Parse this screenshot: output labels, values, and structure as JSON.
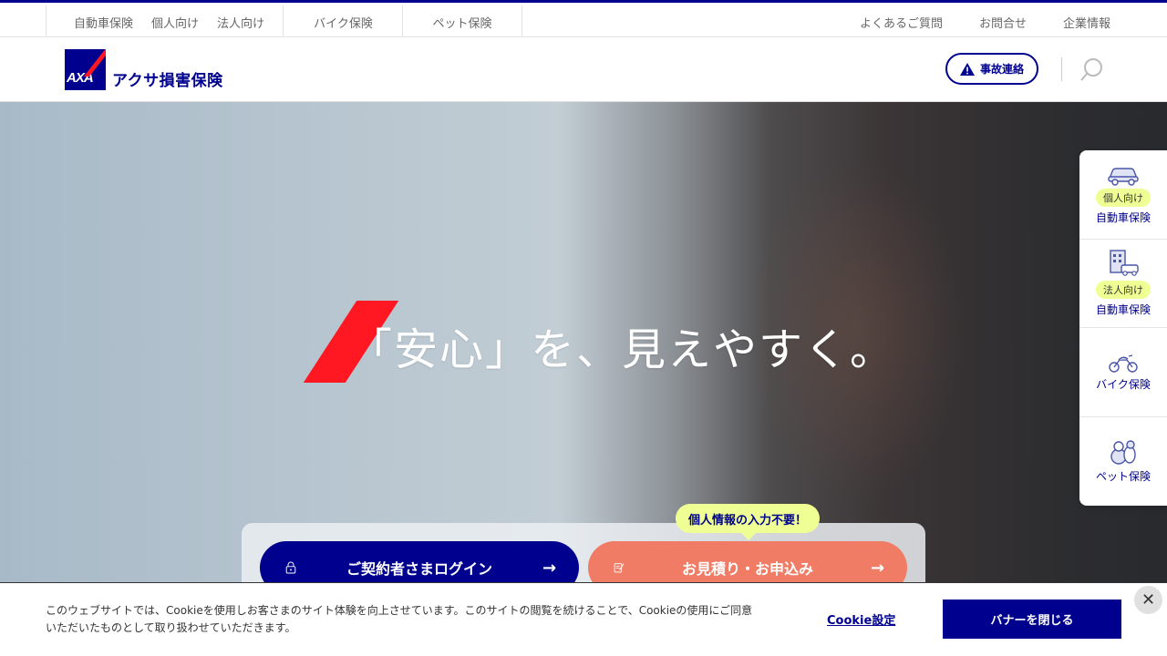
{
  "topnav": {
    "group1": [
      "自動車保険",
      "個人向け",
      "法人向け"
    ],
    "bike": "バイク保険",
    "pet": "ペット保険",
    "right": [
      "よくあるご質問",
      "お問合せ",
      "企業情報"
    ]
  },
  "header": {
    "logo_text": "AXA",
    "brand": "アクサ損害保険",
    "accident_label": "事故連絡"
  },
  "hero": {
    "title": "「安心」を、見えやすく。",
    "bubble": "個人情報の入力不要！",
    "login_label": "ご契約者さまログイン",
    "quote_label": "お見積り・お申込み",
    "arrow": "→"
  },
  "sidenav": [
    {
      "badge": "個人向け",
      "label": "自動車保険",
      "icon": "car-icon"
    },
    {
      "badge": "法人向け",
      "label": "自動車保険",
      "icon": "building-car-icon"
    },
    {
      "badge": "",
      "label": "バイク保険",
      "icon": "motorcycle-icon"
    },
    {
      "badge": "",
      "label": "ペット保険",
      "icon": "pet-icon"
    }
  ],
  "cookie": {
    "text": "このウェブサイトでは、Cookieを使用しお客さまのサイト体験を向上させています。このサイトの閲覧を続けることで、Cookieの使用にご同意いただいたものとして取り扱わせていただきます。",
    "settings": "Cookie設定",
    "close_banner": "バナーを閉じる",
    "close_x": "✕"
  },
  "colors": {
    "primary": "#00008f",
    "accent_red": "#ff1721",
    "quote": "#f07c66",
    "highlight": "#f0ff93"
  }
}
